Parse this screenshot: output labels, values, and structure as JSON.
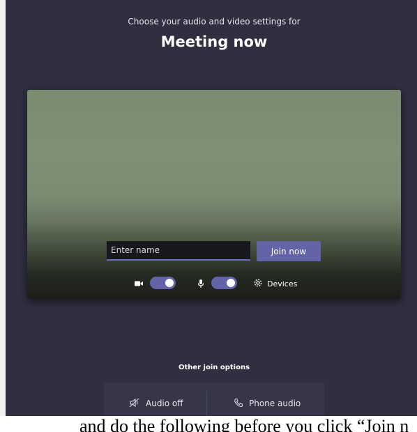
{
  "header": {
    "subtitle": "Choose your audio and video settings for",
    "title": "Meeting now"
  },
  "preview": {
    "name_placeholder": "Enter name",
    "join_label": "Join now",
    "camera_on": true,
    "mic_on": true,
    "devices_label": "Devices",
    "icons": [
      "video-camera-icon",
      "microphone-icon",
      "gear-icon"
    ]
  },
  "other_options": {
    "heading": "Other join options",
    "audio_off_label": "Audio off",
    "phone_audio_label": "Phone audio",
    "icons": [
      "speaker-off-icon",
      "phone-icon"
    ]
  },
  "caption": {
    "text": "and do the following before you click “Join n"
  },
  "colors": {
    "background": "#2f2f40",
    "accent": "#6264a7"
  }
}
